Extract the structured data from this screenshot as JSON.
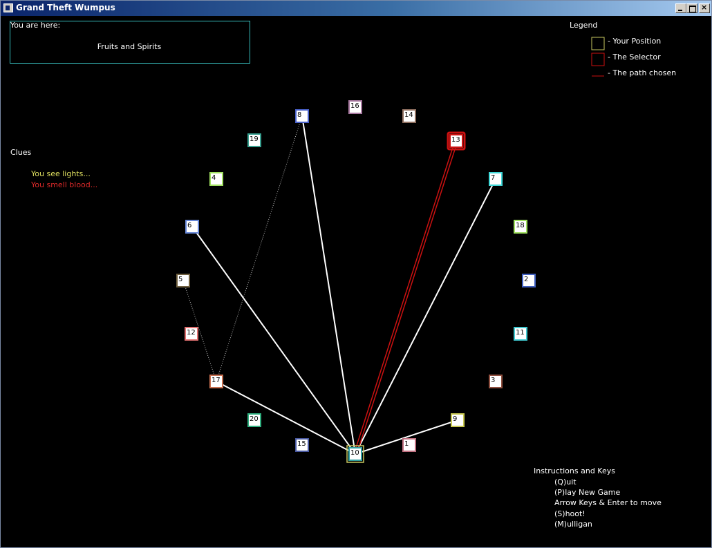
{
  "window": {
    "title": "Grand Theft Wumpus"
  },
  "location": {
    "label": "You are here:",
    "name": "Fruits and Spirits"
  },
  "clues": {
    "heading": "Clues",
    "items": [
      {
        "text": "You see lights...",
        "color": "#e0e060"
      },
      {
        "text": "You smell blood...",
        "color": "#e02a2a"
      }
    ]
  },
  "legend": {
    "heading": "Legend",
    "items": [
      {
        "text": "- Your Position",
        "color": "#c8c860",
        "kind": "box"
      },
      {
        "text": "- The Selector",
        "color": "#cc1111",
        "kind": "box"
      },
      {
        "text": "- The path chosen",
        "color": "#cc1111",
        "kind": "line"
      }
    ]
  },
  "instructions": {
    "heading": "Instructions and Keys",
    "lines": [
      "(Q)uit",
      "(P)lay New Game",
      "Arrow Keys & Enter to move",
      "(S)hoot!",
      "(M)ulligan"
    ]
  },
  "nodes": [
    {
      "id": "8",
      "color": "#4860c8"
    },
    {
      "id": "16",
      "color": "#a878a0"
    },
    {
      "id": "14",
      "color": "#907060"
    },
    {
      "id": "13",
      "color": "#cc1111"
    },
    {
      "id": "19",
      "color": "#38a090"
    },
    {
      "id": "7",
      "color": "#40d8d8"
    },
    {
      "id": "4",
      "color": "#a0e060"
    },
    {
      "id": "18",
      "color": "#a0e060"
    },
    {
      "id": "6",
      "color": "#6888d8"
    },
    {
      "id": "2",
      "color": "#4060c0"
    },
    {
      "id": "5",
      "color": "#706040"
    },
    {
      "id": "12",
      "color": "#e07070"
    },
    {
      "id": "11",
      "color": "#40c8d0"
    },
    {
      "id": "3",
      "color": "#905040"
    },
    {
      "id": "17",
      "color": "#c87050"
    },
    {
      "id": "20",
      "color": "#30b080"
    },
    {
      "id": "9",
      "color": "#c8c850"
    },
    {
      "id": "15",
      "color": "#4858a0"
    },
    {
      "id": "1",
      "color": "#c07080"
    },
    {
      "id": "10",
      "color": "#30a0a0"
    }
  ],
  "current_node": "10",
  "selected_node": "13",
  "colors": {
    "position": "#c8c860",
    "selector": "#cc1111",
    "path": "#cc1111",
    "edge": "#ffffff"
  }
}
